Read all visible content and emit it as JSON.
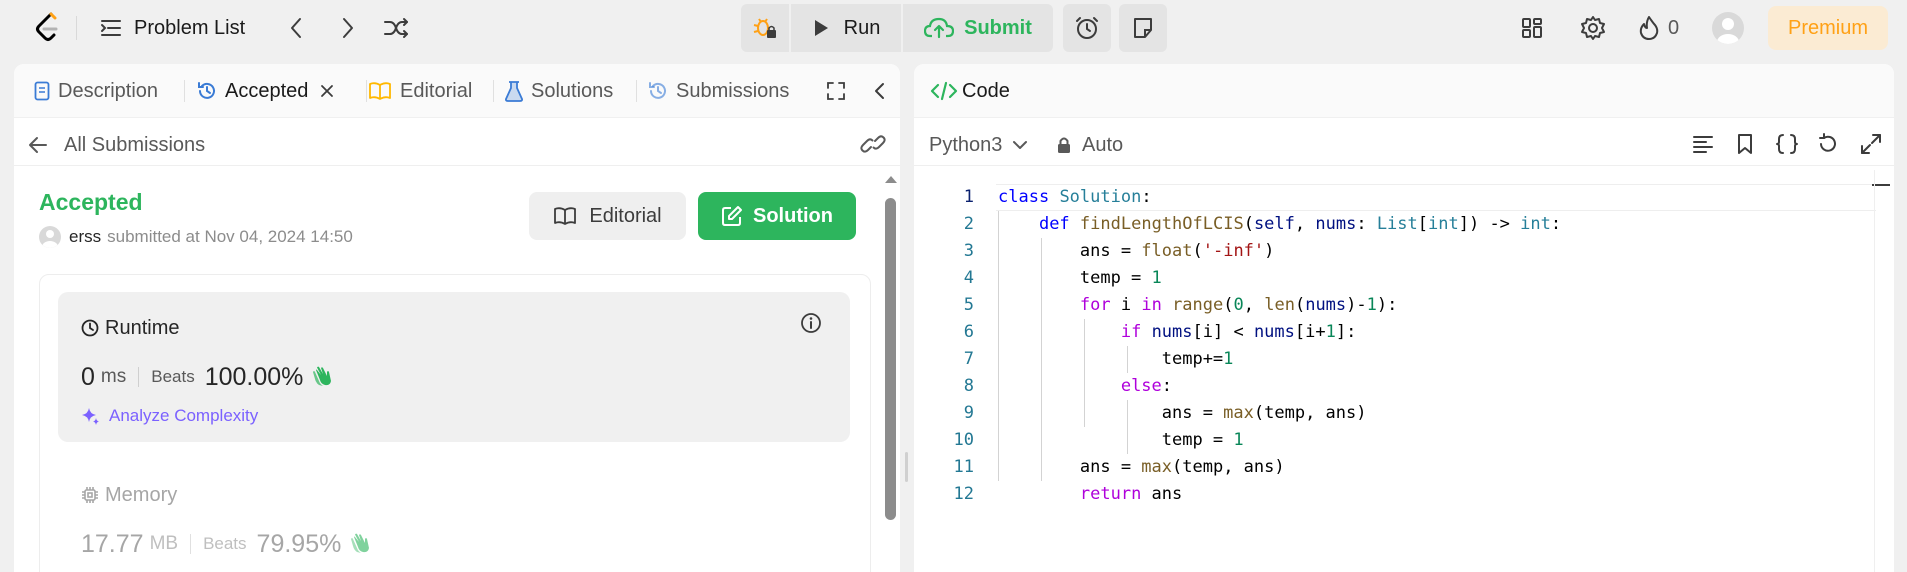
{
  "topbar": {
    "problem_list_label": "Problem List",
    "run_label": "Run",
    "submit_label": "Submit",
    "streak_count": "0",
    "premium_label": "Premium"
  },
  "left_tabs": {
    "description": "Description",
    "accepted": "Accepted",
    "editorial": "Editorial",
    "solutions": "Solutions",
    "submissions": "Submissions"
  },
  "submission": {
    "back_label": "All Submissions",
    "status": "Accepted",
    "username": "erss",
    "submitted_text": "submitted at Nov 04, 2024 14:50",
    "editorial_button": "Editorial",
    "solution_button": "Solution"
  },
  "runtime": {
    "title": "Runtime",
    "value": "0",
    "unit": "ms",
    "beats_label": "Beats",
    "beats_value": "100.00%",
    "analyze_label": "Analyze Complexity"
  },
  "memory": {
    "title": "Memory",
    "value": "17.77",
    "unit": "MB",
    "beats_label": "Beats",
    "beats_value": "79.95%"
  },
  "code_panel": {
    "title": "Code",
    "language": "Python3",
    "mode": "Auto"
  },
  "code_lines": [
    "class Solution:",
    "    def findLengthOfLCIS(self, nums: List[int]) -> int:",
    "        ans = float('-inf')",
    "        temp = 1",
    "        for i in range(0, len(nums)-1):",
    "            if nums[i] < nums[i+1]:",
    "                temp+=1",
    "            else:",
    "                ans = max(temp, ans)",
    "                temp = 1",
    "        ans = max(temp, ans)",
    "        return ans"
  ],
  "line_numbers": [
    "1",
    "2",
    "3",
    "4",
    "5",
    "6",
    "7",
    "8",
    "9",
    "10",
    "11",
    "12"
  ],
  "colors": {
    "accent_green": "#2db55d",
    "premium_text": "#ffa116",
    "premium_bg": "#fbebd3"
  }
}
